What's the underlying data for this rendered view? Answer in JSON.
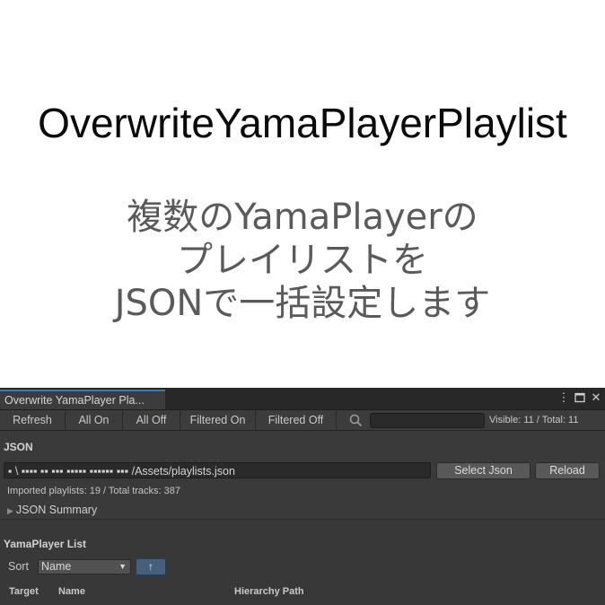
{
  "hero": {
    "title": "OverwriteYamaPlayerPlaylist",
    "subtitle_lines": [
      "複数のYamaPlayerの",
      "プレイリストを",
      "JSONで一括設定します"
    ]
  },
  "window": {
    "tab_title": "Overwrite YamaPlayer Pla...",
    "icons": [
      "more-icon",
      "maximize-icon",
      "close-icon"
    ]
  },
  "toolbar": {
    "refresh": "Refresh",
    "all_on": "All On",
    "all_off": "All Off",
    "filtered_on": "Filtered On",
    "filtered_off": "Filtered Off",
    "search_value": "",
    "visible_total": "Visible: 11 / Total: 11"
  },
  "json_section": {
    "heading": "JSON",
    "path": "▪ \\ ▪▪▪▪ ▪▪ ▪▪▪ ▪▪▪▪▪ ▪▪▪▪▪▪ ▪▪▪ /Assets/playlists.json",
    "select_button": "Select Json",
    "reload_button": "Reload",
    "imported": "Imported playlists: 19 / Total tracks: 387",
    "summary_foldout": "JSON Summary"
  },
  "list_section": {
    "heading": "YamaPlayer List",
    "sort_label": "Sort",
    "sort_value": "Name",
    "sort_direction": "↑",
    "columns": {
      "target": "Target",
      "name": "Name",
      "hierarchy": "Hierarchy Path"
    }
  },
  "colors": {
    "panel_bg": "#383838",
    "accent_tab": "#3a79bb",
    "sort_button": "#46607c"
  }
}
